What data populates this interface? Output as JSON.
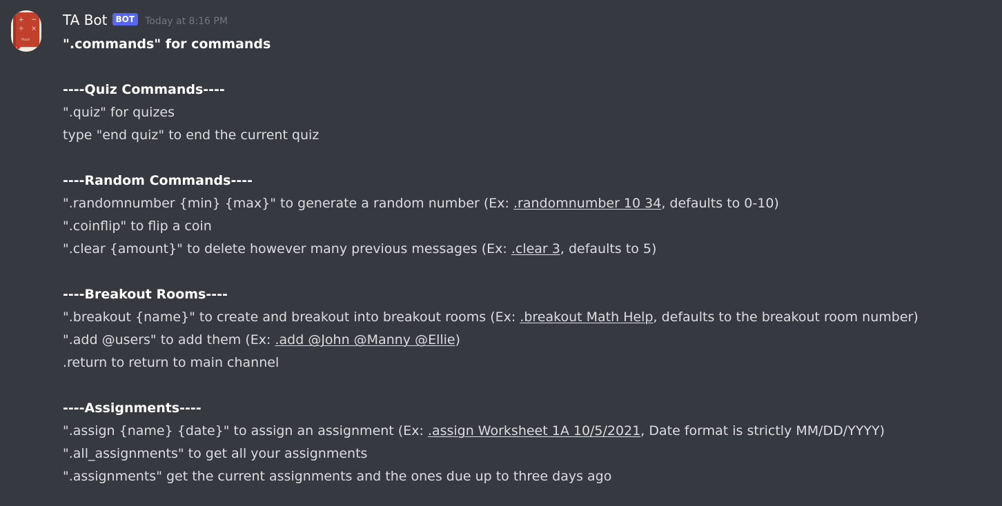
{
  "author": {
    "name": "TA Bot",
    "bot_badge": "BOT",
    "timestamp": "Today at 8:16 PM",
    "avatar": {
      "icon": "math-book-icon",
      "symbols": "+ −\n÷ ×",
      "book_label": "Math",
      "colors": {
        "cover": "#c1402b",
        "spine": "#a73221",
        "background": "#f5efe4",
        "accent": "#ef2525"
      }
    }
  },
  "message": {
    "intro": "\".commands\" for commands",
    "quiz": {
      "heading": "----Quiz Commands----",
      "line1": "\".quiz\" for quizes",
      "line2": "type \"end quiz\" to end the current quiz"
    },
    "random": {
      "heading": "----Random Commands----",
      "randomnumber_pre": "\".randomnumber {min} {max}\" to generate a random number (Ex: ",
      "randomnumber_example": ".randomnumber 10 34",
      "randomnumber_post": ", defaults to 0-10)",
      "coinflip": "\".coinflip\" to flip a coin",
      "clear_pre": "\".clear {amount}\" to delete however many previous messages (Ex: ",
      "clear_example": ".clear 3",
      "clear_post": ", defaults to 5)"
    },
    "breakout": {
      "heading": "----Breakout Rooms----",
      "breakout_pre": "\".breakout {name}\" to create and breakout into breakout rooms (Ex: ",
      "breakout_example": ".breakout Math Help",
      "breakout_post": ", defaults to the breakout room number)",
      "add_pre": "\".add @users\" to add them (Ex: ",
      "add_example": ".add",
      "add_mentions": [
        "@John",
        "@Manny",
        "@Ellie"
      ],
      "add_post": ")",
      "return": ".return to return to main channel"
    },
    "assignments": {
      "heading": "----Assignments----",
      "assign_pre": "\".assign {name} {date}\" to assign an assignment (Ex: ",
      "assign_example": ".assign Worksheet 1A 10/5/2021",
      "assign_post": ", Date format is strictly MM/DD/YYYY)",
      "all": "\".all_assignments\" to get all your assignments",
      "current": "\".assignments\" get the current assignments and the ones due up to three days ago"
    }
  },
  "colors": {
    "background": "#36393f",
    "text": "#dcddde",
    "username": "#ffffff",
    "bot_badge": "#5865f2",
    "timestamp": "#72767d"
  }
}
